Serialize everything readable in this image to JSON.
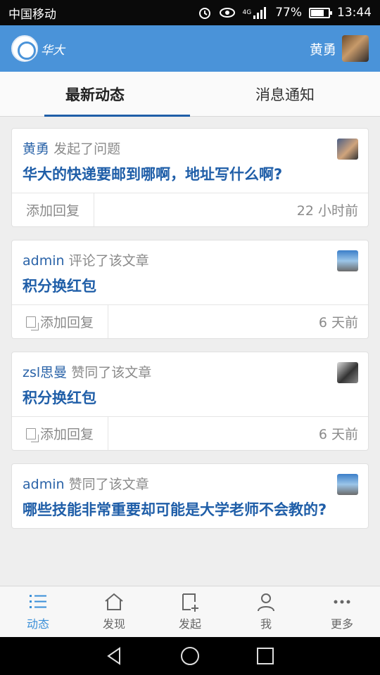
{
  "status_bar": {
    "carrier": "中国移动",
    "network": "4G",
    "battery": "77%",
    "battery_level": 0.77,
    "time": "13:44"
  },
  "header": {
    "logo_text": "华大",
    "user_name": "黄勇"
  },
  "tabs": [
    {
      "label": "最新动态",
      "active": true
    },
    {
      "label": "消息通知",
      "active": false
    }
  ],
  "feed": [
    {
      "author": "黄勇",
      "action": "发起了问题",
      "title": "华大的快递要邮到哪啊，地址写什么啊?",
      "reply_label": "添加回复",
      "time": "22 小时前"
    },
    {
      "author": "admin",
      "action": "评论了该文章",
      "title": "积分换红包",
      "reply_label": "添加回复",
      "time": "6 天前"
    },
    {
      "author": "zsl思曼",
      "action": "赞同了该文章",
      "title": "积分换红包",
      "reply_label": "添加回复",
      "time": "6 天前"
    },
    {
      "author": "admin",
      "action": "赞同了该文章",
      "title": "哪些技能非常重要却可能是大学老师不会教的?"
    }
  ],
  "bottom_nav": [
    {
      "label": "动态",
      "icon": "list-icon",
      "active": true
    },
    {
      "label": "发现",
      "icon": "home-icon",
      "active": false
    },
    {
      "label": "发起",
      "icon": "compose-icon",
      "active": false
    },
    {
      "label": "我",
      "icon": "person-icon",
      "active": false
    },
    {
      "label": "更多",
      "icon": "more-icon",
      "active": false
    }
  ],
  "colors": {
    "accent": "#4a93d9",
    "link": "#1f5ea8",
    "active_nav": "#3a8fd8"
  }
}
